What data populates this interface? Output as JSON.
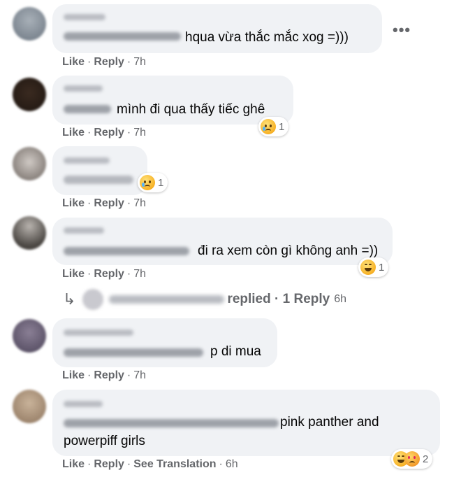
{
  "comments": [
    {
      "text": "hqua vừa thắc mắc xog =)))",
      "like": "Like",
      "reply": "Reply",
      "time": "7h"
    },
    {
      "text": "mình đi qua thấy tiếc ghê",
      "like": "Like",
      "reply": "Reply",
      "time": "7h",
      "reaction_count": "1"
    },
    {
      "text": "",
      "like": "Like",
      "reply": "Reply",
      "time": "7h",
      "reaction_count": "1"
    },
    {
      "text": "đi ra xem còn gì không anh =))",
      "like": "Like",
      "reply": "Reply",
      "time": "7h",
      "reaction_count": "1"
    },
    {
      "text": "p di mua",
      "like": "Like",
      "reply": "Reply",
      "time": "7h"
    },
    {
      "text_line1": "pink panther and",
      "text_line2": "powerpiff girls",
      "like": "Like",
      "reply": "Reply",
      "see_translation": "See Translation",
      "time": "6h",
      "reaction_count": "2"
    }
  ],
  "replied": {
    "label": "replied",
    "count": "1 Reply",
    "time": "6h"
  },
  "menu_icon": "more-horizontal-icon",
  "reaction_icons": [
    "sad-emoji-icon",
    "haha-emoji-icon",
    "heart-eyes-emoji-icon"
  ],
  "colors": {
    "bubble": "#f0f2f5",
    "meta": "#65676b",
    "text": "#050505"
  }
}
